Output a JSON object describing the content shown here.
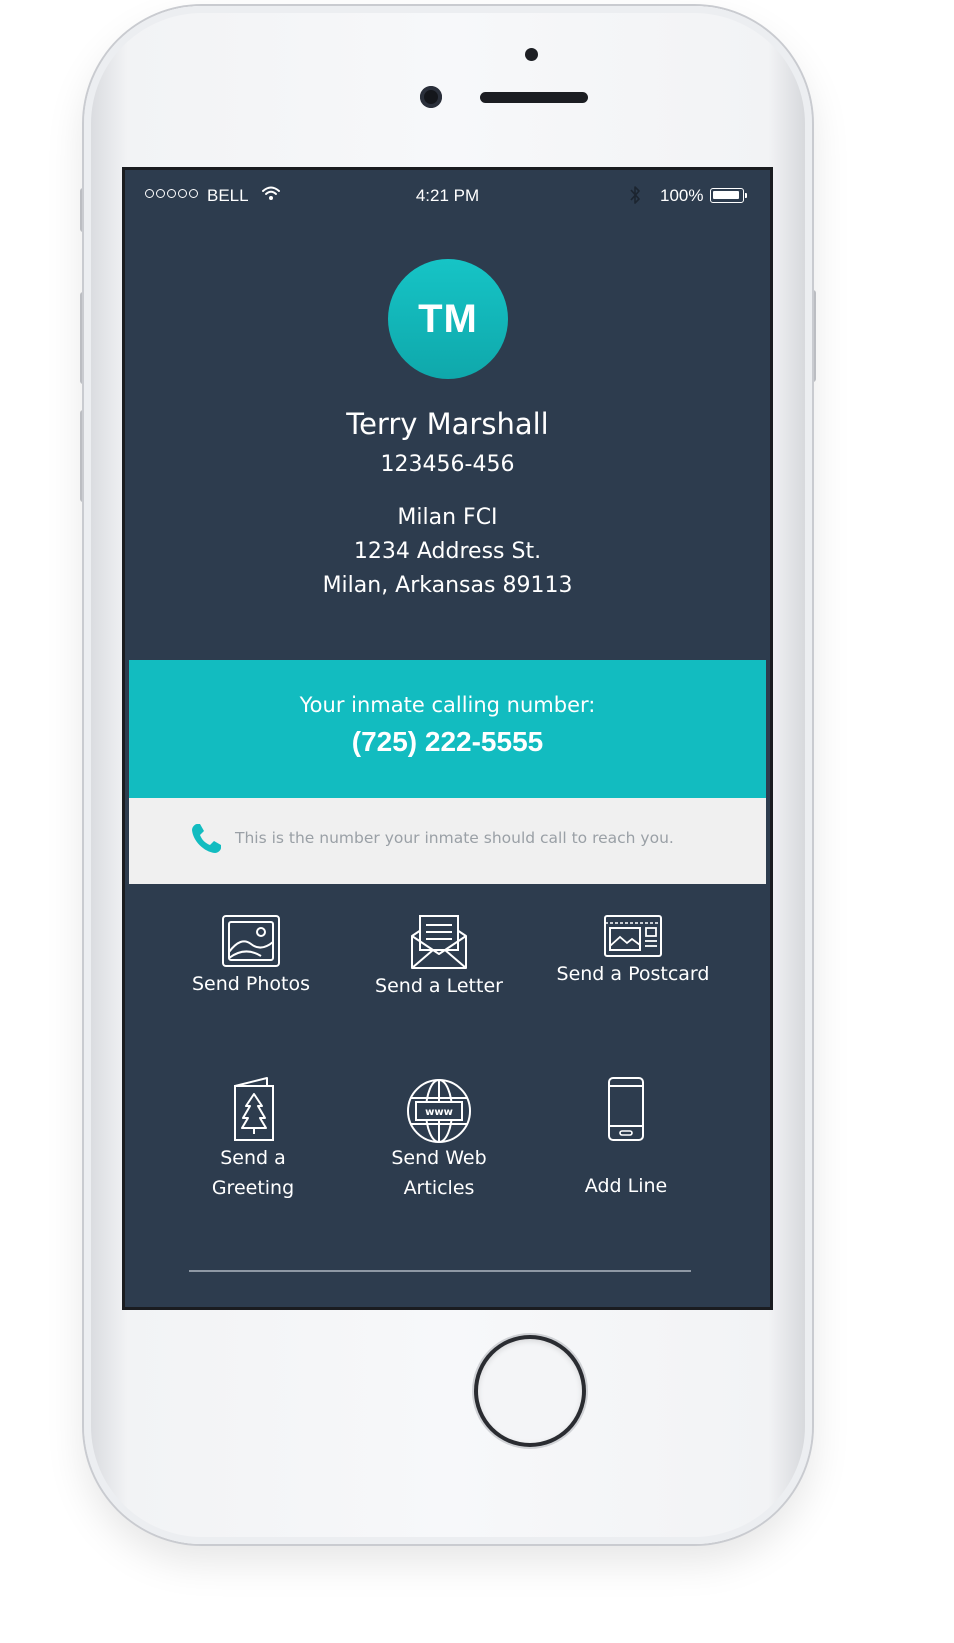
{
  "status_bar": {
    "carrier": "BELL",
    "time": "4:21 PM",
    "battery": "100%"
  },
  "profile": {
    "initials": "TM",
    "name": "Terry Marshall",
    "inmate_id": "123456-456",
    "facility": "Milan FCI",
    "street": "1234 Address St.",
    "city_line": "Milan, Arkansas 89113"
  },
  "calling": {
    "label": "Your inmate calling number:",
    "number": "(725) 222-5555",
    "note": "This is the number your inmate should call to reach you."
  },
  "actions": {
    "send_photos": "Send Photos",
    "send_letter": "Send a Letter",
    "send_postcard": "Send a Postcard",
    "send_greeting_1": "Send a",
    "send_greeting_2": "Greeting",
    "send_web_1": "Send Web",
    "send_web_2": "Articles",
    "web_icon_text": "www",
    "add_line": "Add Line"
  },
  "colors": {
    "background": "#2d3c4e",
    "accent": "#12bcc0",
    "info_band": "#f0f0f0"
  }
}
